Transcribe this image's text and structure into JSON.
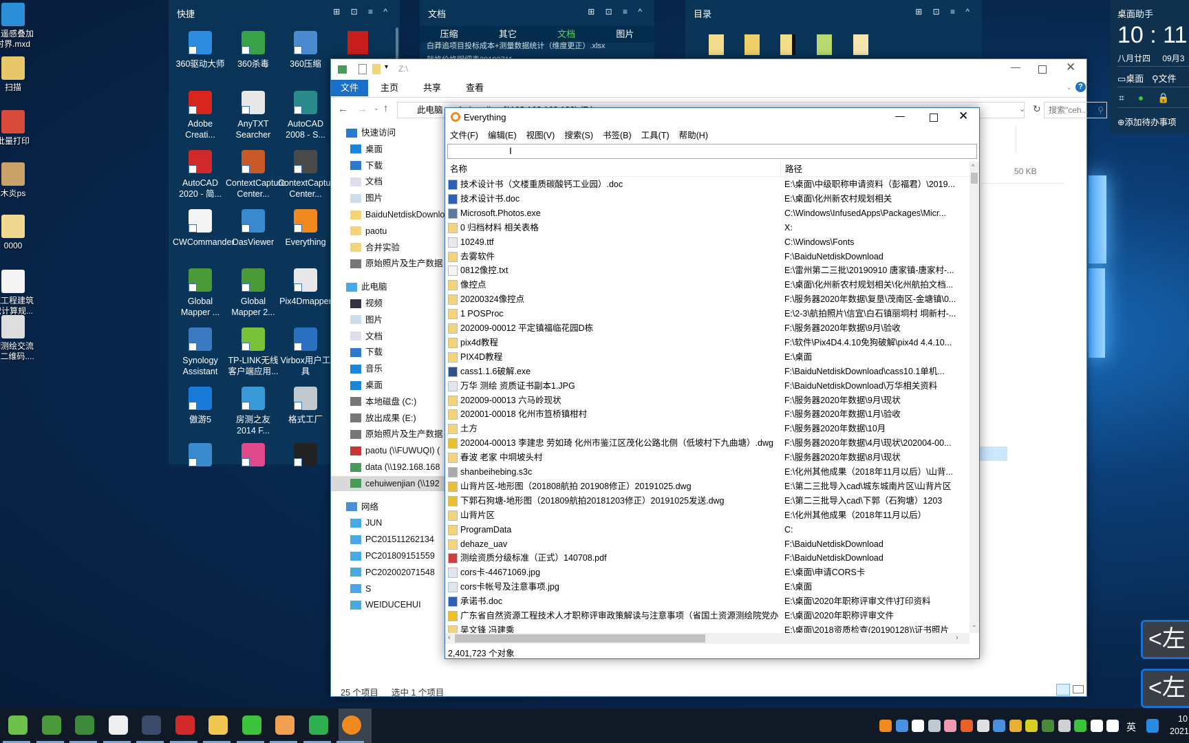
{
  "desktop": {
    "icons": [
      {
        "label": "閤遥感叠加\n时界.mxd",
        "color": "#2a8fd6"
      },
      {
        "label": "扫描",
        "color": "#e8c66a"
      },
      {
        "label": "批量打印",
        "color": "#d84a3a"
      },
      {
        "label": "木炎ps",
        "color": "#c9a26a"
      },
      {
        "label": "0000",
        "color": "#f0d890"
      },
      {
        "label": "筑工程建筑\n识计算规...",
        "color": "#f4f4f4"
      },
      {
        "label": "测测绘交流\n群二维码....",
        "color": "#dddddd"
      }
    ]
  },
  "quick_panel": {
    "title": "快捷",
    "controls": "⊞ ⊡ ≡ ^",
    "icons": [
      {
        "label": "360驱动大师",
        "color": "#2e8ce0"
      },
      {
        "label": "360杀毒",
        "color": "#3aa34a"
      },
      {
        "label": "360压缩",
        "color": "#4a8ad0"
      },
      {
        "label": "Adobe Creati...",
        "color": "#d8261f"
      },
      {
        "label": "AnyTXT Searcher",
        "color": "#e8e8e8"
      },
      {
        "label": "AutoCAD 2008 - S...",
        "color": "#2b8a8a"
      },
      {
        "label": "AutoCAD 2020 - 简...",
        "color": "#d22a2a"
      },
      {
        "label": "ContextCapture Center...",
        "color": "#c85a2a"
      },
      {
        "label": "ContextCapture Center...",
        "color": "#4a4a4a"
      },
      {
        "label": "CWCommander",
        "color": "#f4f4f4"
      },
      {
        "label": "DasViewer",
        "color": "#3a8ad0"
      },
      {
        "label": "Everything",
        "color": "#f08a20"
      },
      {
        "label": "Global Mapper ...",
        "color": "#4a9a3a"
      },
      {
        "label": "Global Mapper 2...",
        "color": "#4a9a3a"
      },
      {
        "label": "Pix4Dmapper",
        "color": "#e8e8e8"
      },
      {
        "label": "Synology Assistant",
        "color": "#3a7ac0"
      },
      {
        "label": "TP-LINK无线客户端应用...",
        "color": "#7ac23a"
      },
      {
        "label": "Virbox用户工具",
        "color": "#2a70c0"
      },
      {
        "label": "傲游5",
        "color": "#1a7ad8"
      },
      {
        "label": "房测之友 2014 F...",
        "color": "#3a9ad8"
      },
      {
        "label": "格式工厂",
        "color": "#c0c8d0"
      },
      {
        "label": "",
        "color": "#3a8ad0"
      },
      {
        "label": "",
        "color": "#e04a8a"
      },
      {
        "label": "",
        "color": "#222222"
      }
    ],
    "partial_icon_color": "#c81e1e"
  },
  "docs_panel": {
    "title": "文档",
    "controls": "⊞ ⊡ ≡ ^",
    "tabs": [
      "压缩",
      "其它",
      "文档",
      "图片"
    ],
    "active_tab": 2,
    "files": [
      "白莽追项目投标成本+测量数据统计（维度更正）.xlsx",
      "就格价格明细表20190711..."
    ]
  },
  "dir_panel": {
    "title": "目录",
    "controls": "⊞ ⊡ ≡ ^"
  },
  "assistant": {
    "title": "桌面助手",
    "time": "10 : 11",
    "lunar": "八月廿四",
    "date": "09月3",
    "desktop": "桌面",
    "files": "文件",
    "add_todo": "⊕添加待办事项"
  },
  "explorer": {
    "title": "Z:\\",
    "ribbon_tabs": [
      "文件",
      "主页",
      "共享",
      "查看"
    ],
    "address": "此电脑 › cehuiwenjian (\\\\192.168.168.188) (Z:)",
    "search_placeholder": "搜索\"ceh...",
    "size_text": "50 KB",
    "nav": [
      {
        "label": "快速访问",
        "icon": "star",
        "level": 0
      },
      {
        "label": "桌面",
        "icon": "desktop",
        "level": 1
      },
      {
        "label": "下载",
        "icon": "download",
        "level": 1
      },
      {
        "label": "文档",
        "icon": "document",
        "level": 1
      },
      {
        "label": "图片",
        "icon": "picture",
        "level": 1
      },
      {
        "label": "BaiduNetdiskDownload",
        "icon": "folder",
        "level": 1
      },
      {
        "label": "paotu",
        "icon": "folder",
        "level": 1
      },
      {
        "label": "合并实验",
        "icon": "folder",
        "level": 1
      },
      {
        "label": "原始照片及生产数据",
        "icon": "drive",
        "level": 1
      },
      {
        "label": "此电脑",
        "icon": "computer",
        "level": 0
      },
      {
        "label": "视频",
        "icon": "video",
        "level": 1
      },
      {
        "label": "图片",
        "icon": "picture",
        "level": 1
      },
      {
        "label": "文档",
        "icon": "document",
        "level": 1
      },
      {
        "label": "下载",
        "icon": "download",
        "level": 1
      },
      {
        "label": "音乐",
        "icon": "music",
        "level": 1
      },
      {
        "label": "桌面",
        "icon": "desktop",
        "level": 1
      },
      {
        "label": "本地磁盘 (C:)",
        "icon": "drive",
        "level": 1
      },
      {
        "label": "放出成果 (E:)",
        "icon": "drive",
        "level": 1
      },
      {
        "label": "原始照片及生产数据",
        "icon": "drive",
        "level": 1
      },
      {
        "label": "paotu (\\\\FUWUQI) (",
        "icon": "net-drive-off",
        "level": 1
      },
      {
        "label": "data (\\\\192.168.168",
        "icon": "net-drive",
        "level": 1
      },
      {
        "label": "cehuiwenjian (\\\\192",
        "icon": "net-drive",
        "level": 1,
        "selected": true
      },
      {
        "label": "网络",
        "icon": "network",
        "level": 0
      },
      {
        "label": "JUN",
        "icon": "computer",
        "level": 1
      },
      {
        "label": "PC201511262134",
        "icon": "computer",
        "level": 1
      },
      {
        "label": "PC201809151559",
        "icon": "computer",
        "level": 1
      },
      {
        "label": "PC202002071548",
        "icon": "computer",
        "level": 1
      },
      {
        "label": "S",
        "icon": "computer",
        "level": 1
      },
      {
        "label": "WEIDUCEHUI",
        "icon": "computer",
        "level": 1
      }
    ],
    "status_count": "25 个项目",
    "status_selected": "选中 1 个项目"
  },
  "everything": {
    "title": "Everything",
    "menu": [
      "文件(F)",
      "编辑(E)",
      "视图(V)",
      "搜索(S)",
      "书签(B)",
      "工具(T)",
      "帮助(H)"
    ],
    "search_value": "",
    "columns": [
      "名称",
      "路径"
    ],
    "rows": [
      {
        "name": "技术设计书（文楼重质碳酸钙工业园）.doc",
        "path": "E:\\桌面\\中级职称申请资料（彭福君）\\2019...",
        "type": "word"
      },
      {
        "name": "技术设计书.doc",
        "path": "E:\\桌面\\化州新农村规划相关",
        "type": "word"
      },
      {
        "name": "Microsoft.Photos.exe",
        "path": "C:\\Windows\\InfusedApps\\Packages\\Micr...",
        "type": "exe"
      },
      {
        "name": "0 归档材料  相关表格",
        "path": "X:",
        "type": "folder"
      },
      {
        "name": "10249.ttf",
        "path": "C:\\Windows\\Fonts",
        "type": "font"
      },
      {
        "name": "去雾软件",
        "path": "F:\\BaiduNetdiskDownload",
        "type": "folder"
      },
      {
        "name": "0812像控.txt",
        "path": "E:\\雷州第二三批\\20190910 唐家镇-唐家村-...",
        "type": "txt"
      },
      {
        "name": "像控点",
        "path": "E:\\桌面\\化州新农村规划相关\\化州航拍文档...",
        "type": "folder"
      },
      {
        "name": "20200324像控点",
        "path": "F:\\服务器2020年数据\\复垦\\茂南区-金塘镇\\0...",
        "type": "folder"
      },
      {
        "name": "1 POSProc",
        "path": "E:\\2-3\\航拍照片\\信宜\\白石镇丽垌村 垌新村-...",
        "type": "folder"
      },
      {
        "name": "202009-00012 平定镇福临花园D栋",
        "path": "F:\\服务器2020年数据\\9月\\验收",
        "type": "folder"
      },
      {
        "name": "pix4d教程",
        "path": "F:\\软件\\Pix4D4.4.10免狗破解\\pix4d 4.4.10...",
        "type": "folder"
      },
      {
        "name": "PIX4D教程",
        "path": "E:\\桌面",
        "type": "folder"
      },
      {
        "name": "cass1.1.6破解.exe",
        "path": "F:\\BaiduNetdiskDownload\\cass10.1单机...",
        "type": "app"
      },
      {
        "name": "万华 测绘 资质证书副本1.JPG",
        "path": "F:\\BaiduNetdiskDownload\\万华相关资料",
        "type": "jpg"
      },
      {
        "name": "202009-00013 六马岭现状",
        "path": "F:\\服务器2020年数据\\9月\\现状",
        "type": "folder"
      },
      {
        "name": "202001-00018  化州市笪桥镇柑村",
        "path": "F:\\服务器2020年数据\\1月\\验收",
        "type": "folder"
      },
      {
        "name": "土方",
        "path": "F:\\服务器2020年数据\\10月",
        "type": "folder"
      },
      {
        "name": "202004-00013 李建忠   劳如琦 化州市鉴江区茂化公路北侧（低坡村下九曲塘）.dwg",
        "path": "F:\\服务器2020年数据\\4月\\现状\\202004-00...",
        "type": "dwg"
      },
      {
        "name": "春波 老家 中垌坡头村",
        "path": "F:\\服务器2020年数据\\8月\\现状",
        "type": "folder"
      },
      {
        "name": "shanbeihebing.s3c",
        "path": "E:\\化州其他成果（2018年11月以后）\\山背...",
        "type": "generic"
      },
      {
        "name": "山背片区-地形图（201808航拍 201908修正）20191025.dwg",
        "path": "E:\\第二三批导入cad\\城东城南片区\\山背片区",
        "type": "dwg"
      },
      {
        "name": "下郭石狗塘-地形图（201809航拍20181203修正）20191025发送.dwg",
        "path": "E:\\第二三批导入cad\\下郭（石狗塘）1203",
        "type": "dwg"
      },
      {
        "name": "山背片区",
        "path": "E:\\化州其他成果（2018年11月以后）",
        "type": "folder"
      },
      {
        "name": "ProgramData",
        "path": "C:",
        "type": "folder"
      },
      {
        "name": "dehaze_uav",
        "path": "F:\\BaiduNetdiskDownload",
        "type": "folder"
      },
      {
        "name": "测绘资质分级标准（正式）140708.pdf",
        "path": "F:\\BaiduNetdiskDownload",
        "type": "pdf"
      },
      {
        "name": "cors卡-44671069.jpg",
        "path": "E:\\桌面\\申请CORS卡",
        "type": "jpg"
      },
      {
        "name": "cors卡帐号及注意事项.jpg",
        "path": "E:\\桌面",
        "type": "jpg"
      },
      {
        "name": "承诺书.doc",
        "path": "E:\\桌面\\2020年职称评审文件\\打印资料",
        "type": "word"
      },
      {
        "name": "广东省自然资源工程技术人才职称评审政策解读与注意事项（省国土资源测绘院党办...",
        "path": "E:\\桌面\\2020年职称评审文件",
        "type": "video"
      },
      {
        "name": "吴文锋 冯建乘",
        "path": "E:\\桌面\\2018资质检查(20190128)\\证书照片",
        "type": "folder"
      }
    ],
    "status": "2,401,723 个对象"
  },
  "overlay": {
    "left_button": "<左"
  },
  "taskbar": {
    "apps": [
      {
        "name": "browser-360",
        "color": "#6cc24a"
      },
      {
        "name": "global-mapper",
        "color": "#4a9a3a"
      },
      {
        "name": "global-mapper-2",
        "color": "#3a8a3a"
      },
      {
        "name": "cass",
        "color": "#eeeeee"
      },
      {
        "name": "globe-app",
        "color": "#3a4a6a"
      },
      {
        "name": "autocad",
        "color": "#d22a2a"
      },
      {
        "name": "file-explorer",
        "color": "#f0c850"
      },
      {
        "name": "wechat",
        "color": "#3cc43c"
      },
      {
        "name": "orange-app",
        "color": "#f0a050"
      },
      {
        "name": "wps-sheets",
        "color": "#2fb050"
      },
      {
        "name": "everything",
        "color": "#f08a20"
      }
    ],
    "tray_icons": [
      {
        "name": "everything",
        "color": "#f08a20"
      },
      {
        "name": "virbox",
        "color": "#4a90e0"
      },
      {
        "name": "bookmark",
        "color": "#ffffff"
      },
      {
        "name": "keyboard",
        "color": "#c0c8d0"
      },
      {
        "name": "flower",
        "color": "#f09ab0"
      },
      {
        "name": "app-orange",
        "color": "#e8602a"
      },
      {
        "name": "cloud",
        "color": "#e0e0e0"
      },
      {
        "name": "signal",
        "color": "#4a90e0"
      },
      {
        "name": "qq",
        "color": "#e8b030"
      },
      {
        "name": "plus-app",
        "color": "#d8d020"
      },
      {
        "name": "nvidia",
        "color": "#4a8a3a"
      },
      {
        "name": "satellite",
        "color": "#d0d0d0"
      },
      {
        "name": "wechat",
        "color": "#3cc43c"
      },
      {
        "name": "wifi",
        "color": "#ffffff"
      },
      {
        "name": "volume",
        "color": "#ffffff"
      }
    ],
    "ime": "英",
    "clock_time": "10",
    "clock_date": "2021-"
  }
}
